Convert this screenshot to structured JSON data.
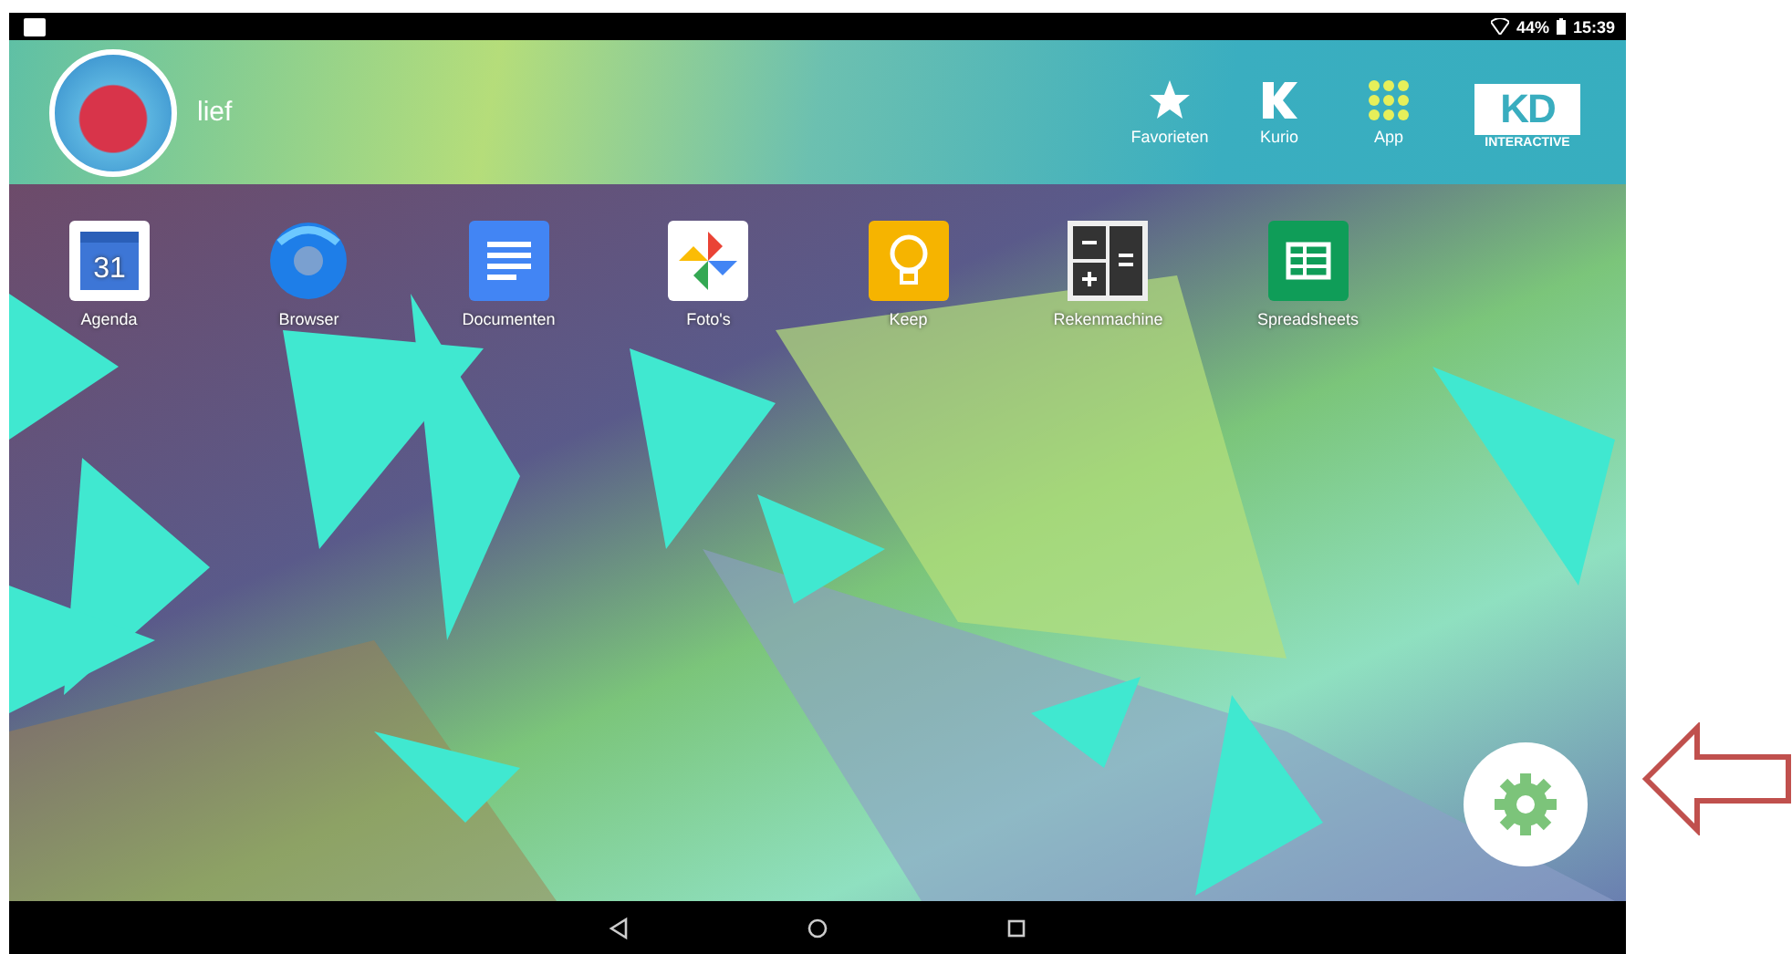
{
  "status_bar": {
    "battery": "44%",
    "time": "15:39"
  },
  "header": {
    "user_name": "lief",
    "shortcuts": [
      {
        "label": "Favorieten",
        "kind": "star"
      },
      {
        "label": "Kurio",
        "kind": "k"
      },
      {
        "label": "App",
        "kind": "grid"
      }
    ],
    "logo": {
      "mark": "KD",
      "tagline": "INTERACTIVE"
    }
  },
  "apps": [
    {
      "label": "Agenda",
      "kind": "calendar",
      "badge": "31"
    },
    {
      "label": "Browser",
      "kind": "browser"
    },
    {
      "label": "Documenten",
      "kind": "docs"
    },
    {
      "label": "Foto's",
      "kind": "photos"
    },
    {
      "label": "Keep",
      "kind": "keep"
    },
    {
      "label": "Rekenmachine",
      "kind": "calculator"
    },
    {
      "label": "Spreadsheets",
      "kind": "sheets"
    }
  ],
  "nav_bar": [
    {
      "kind": "back"
    },
    {
      "kind": "home"
    },
    {
      "kind": "recents"
    }
  ]
}
